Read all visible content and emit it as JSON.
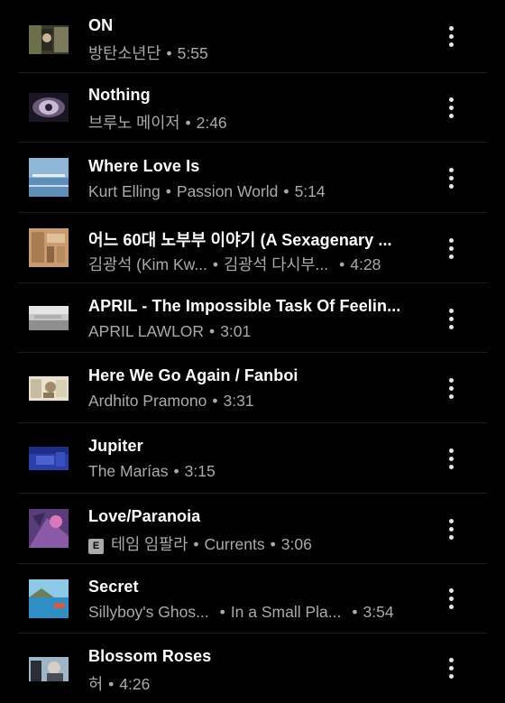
{
  "songs": [
    {
      "title": "ON",
      "artist": "방탄소년단",
      "duration": "5:55"
    },
    {
      "title": "Nothing",
      "artist": "브루노 메이저",
      "duration": "2:46"
    },
    {
      "title": "Where Love Is",
      "artist": "Kurt Elling",
      "album": "Passion World",
      "duration": "5:14"
    },
    {
      "title": "어느 60대 노부부 이야기 (A Sexagenary ...",
      "artist": "김광석 (Kim Kw...",
      "album": "김광석 다시부...",
      "duration": "4:28"
    },
    {
      "title": "APRIL - The Impossible Task Of Feelin...",
      "artist": "APRIL LAWLOR",
      "duration": "3:01"
    },
    {
      "title": "Here We Go Again / Fanboi",
      "artist": "Ardhito Pramono",
      "duration": "3:31"
    },
    {
      "title": "Jupiter",
      "artist": "The Marías",
      "duration": "3:15"
    },
    {
      "title": "Love/Paranoia",
      "explicit_badge": "E",
      "artist": "테임 임팔라",
      "album": "Currents",
      "duration": "3:06"
    },
    {
      "title": "Secret",
      "artist": "Sillyboy's Ghos...",
      "album": "In a Small Pla...",
      "duration": "3:54"
    },
    {
      "title": "Blossom Roses",
      "artist": "허",
      "duration": "4:26"
    }
  ],
  "separator": "•",
  "colors": {
    "background": "#000000",
    "title": "#ffffff",
    "subtitle": "#aaaaaa",
    "divider": "#1f1f1f"
  },
  "icons": {
    "menu": "more-vert-icon",
    "explicit": "explicit-badge-icon"
  }
}
